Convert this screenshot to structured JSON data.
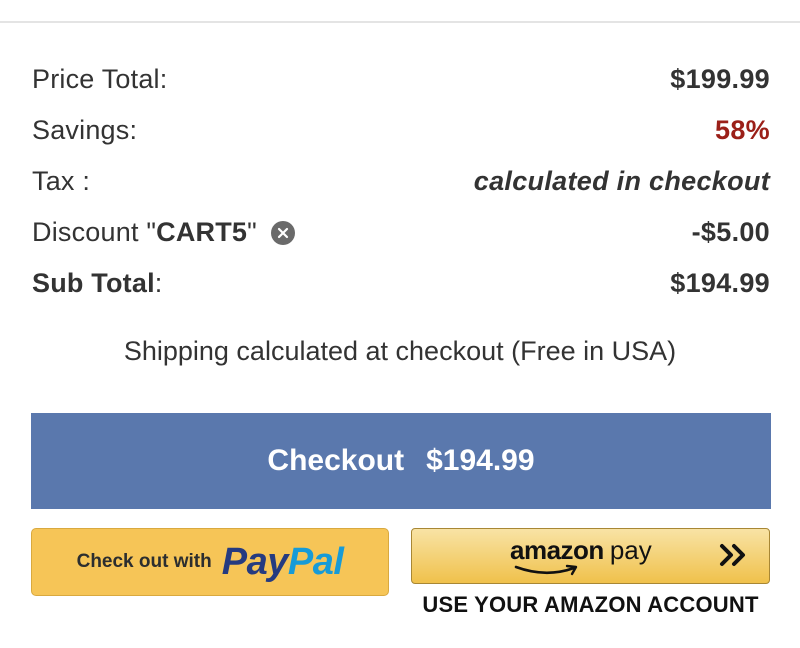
{
  "summary": {
    "price_total_label": "Price Total:",
    "price_total_value": "$199.99",
    "savings_label": "Savings:",
    "savings_value": "58%",
    "tax_label": "Tax :",
    "tax_value": "calculated in checkout",
    "discount_label_prefix": "Discount \"",
    "discount_code": "CART5",
    "discount_label_suffix": "\"",
    "discount_value": "-$5.00",
    "subtotal_label": "Sub Total",
    "subtotal_colon": ":",
    "subtotal_value": "$194.99"
  },
  "shipping_note": "Shipping calculated at checkout (Free in USA)",
  "checkout_button": {
    "label": "Checkout",
    "amount": "$194.99",
    "color": "#5a78ad"
  },
  "paypal_button": {
    "prefix": "Check out with",
    "logo_pay": "Pay",
    "logo_pal": "Pal"
  },
  "amazon_button": {
    "logo_amazon": "amazon",
    "logo_pay": "pay",
    "caption": "USE YOUR AMAZON ACCOUNT"
  },
  "colors": {
    "savings": "#9b2019",
    "paypal_bg": "#f6c557",
    "amazon_bg": "#f0c14b"
  },
  "icons": {
    "remove_discount": "close-circle-icon",
    "amazon_arrow": "double-chevron-right-icon",
    "amazon_smile": "amazon-smile-icon"
  }
}
